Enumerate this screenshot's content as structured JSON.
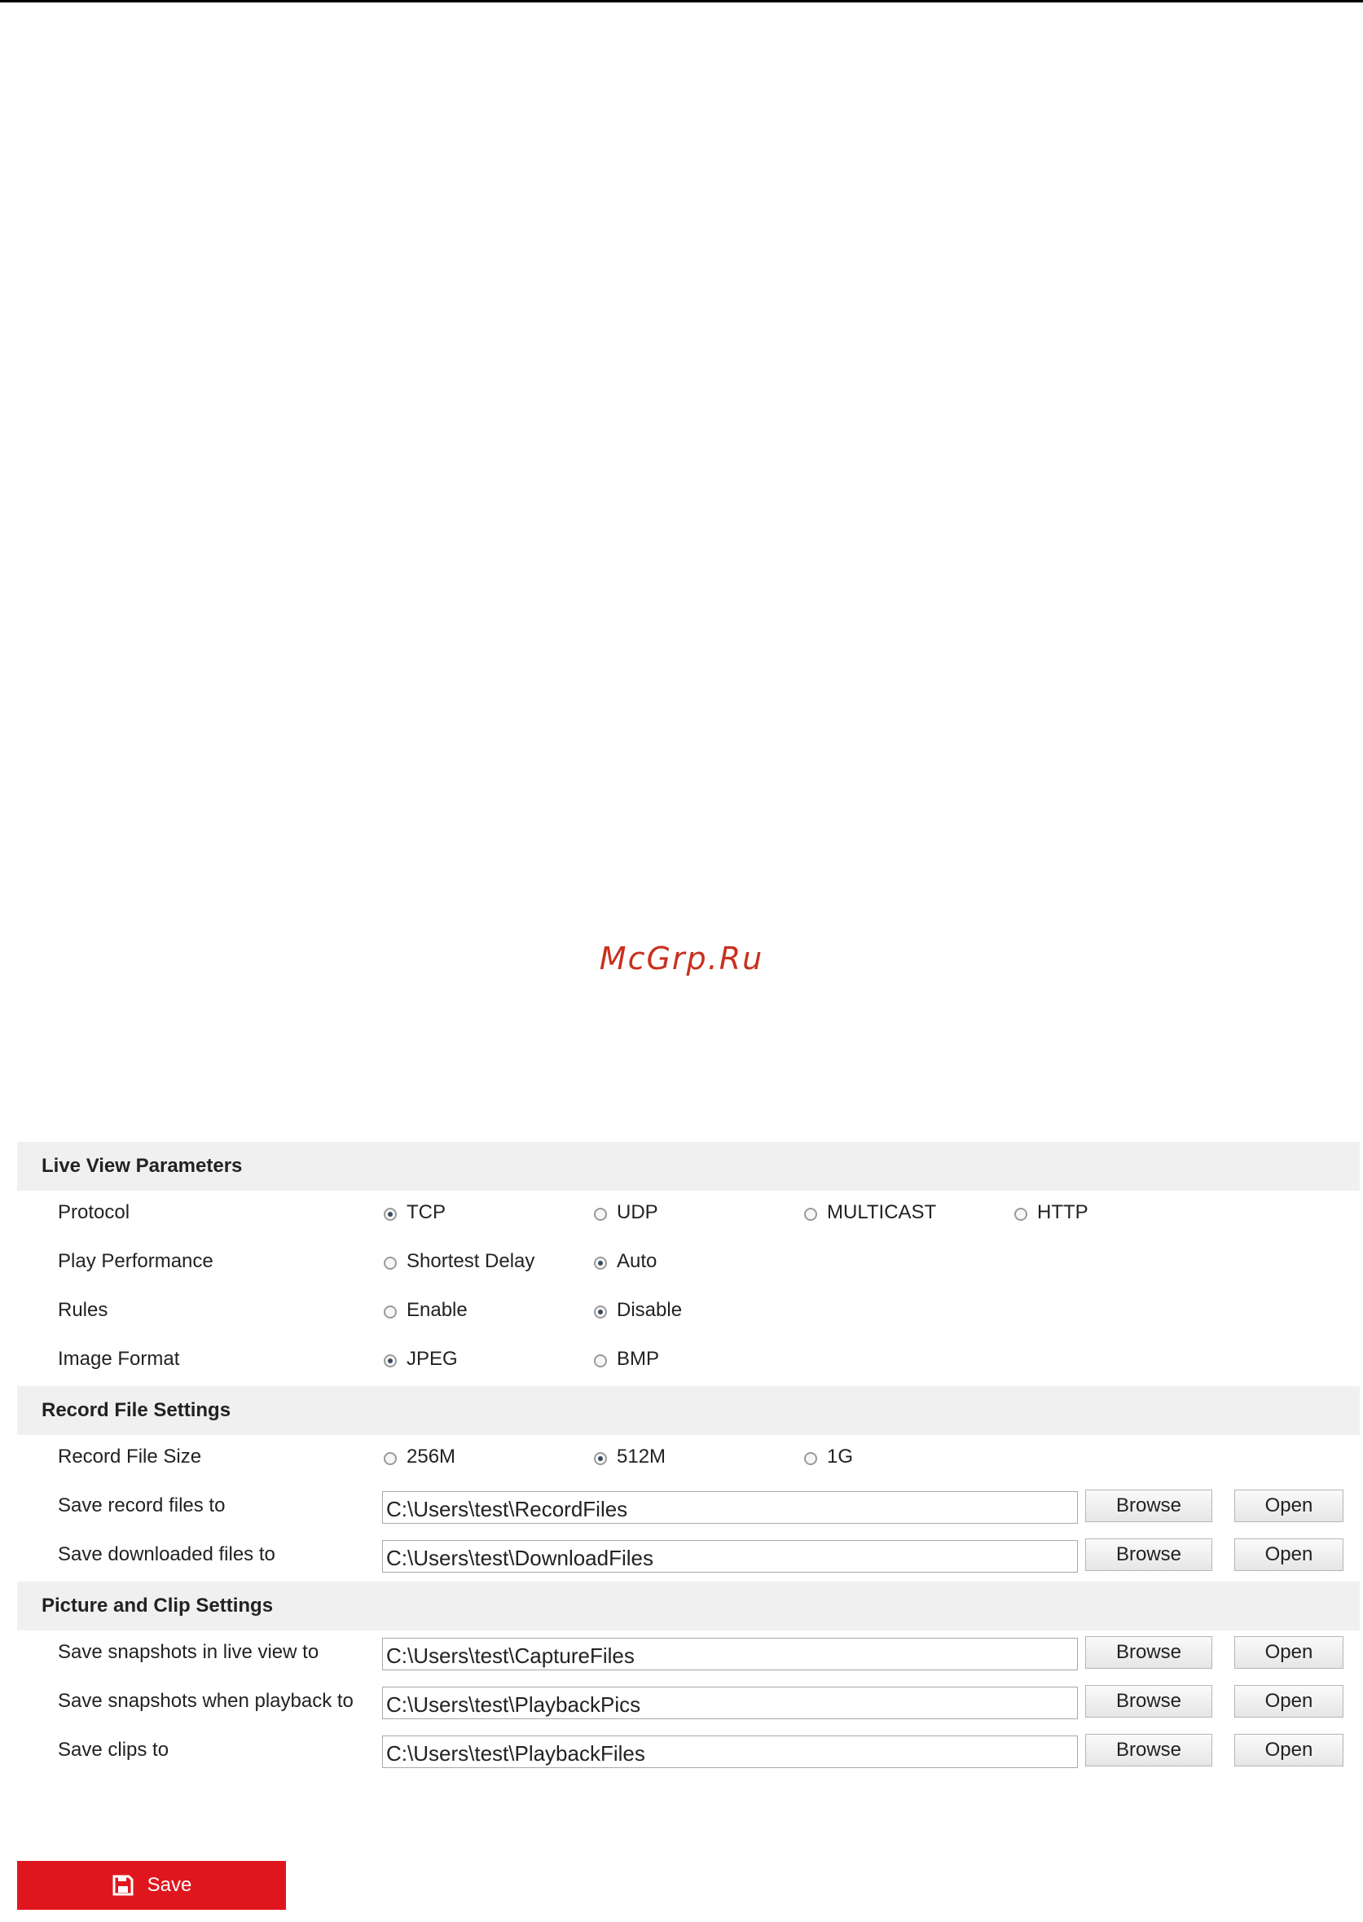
{
  "watermark": "McGrp.Ru",
  "sections": {
    "live_view": {
      "title": "Live View Parameters",
      "protocol": {
        "label": "Protocol",
        "options": [
          "TCP",
          "UDP",
          "MULTICAST",
          "HTTP"
        ],
        "selected": "TCP"
      },
      "play_performance": {
        "label": "Play Performance",
        "options": [
          "Shortest Delay",
          "Auto"
        ],
        "selected": "Auto"
      },
      "rules": {
        "label": "Rules",
        "options": [
          "Enable",
          "Disable"
        ],
        "selected": "Disable"
      },
      "image_format": {
        "label": "Image Format",
        "options": [
          "JPEG",
          "BMP"
        ],
        "selected": "JPEG"
      }
    },
    "record_file": {
      "title": "Record File Settings",
      "file_size": {
        "label": "Record File Size",
        "options": [
          "256M",
          "512M",
          "1G"
        ],
        "selected": "512M"
      },
      "save_record": {
        "label": "Save record files to",
        "value": "C:\\Users\\test\\RecordFiles"
      },
      "save_downloaded": {
        "label": "Save downloaded files to",
        "value": "C:\\Users\\test\\DownloadFiles"
      }
    },
    "picture_clip": {
      "title": "Picture and Clip Settings",
      "snapshots_live": {
        "label": "Save snapshots in live view to",
        "value": "C:\\Users\\test\\CaptureFiles"
      },
      "snapshots_playback": {
        "label": "Save snapshots when playback to",
        "value": "C:\\Users\\test\\PlaybackPics"
      },
      "clips": {
        "label": "Save clips to",
        "value": "C:\\Users\\test\\PlaybackFiles"
      }
    }
  },
  "buttons": {
    "browse": "Browse",
    "open": "Open",
    "save": "Save"
  },
  "colors": {
    "accent_red": "#e0161e",
    "section_bg": "#f0f0f0",
    "watermark": "#c8301e"
  },
  "icons": {
    "save": "floppy-disk-icon",
    "radio_on": "radio-checked",
    "radio_off": "radio-unchecked"
  }
}
